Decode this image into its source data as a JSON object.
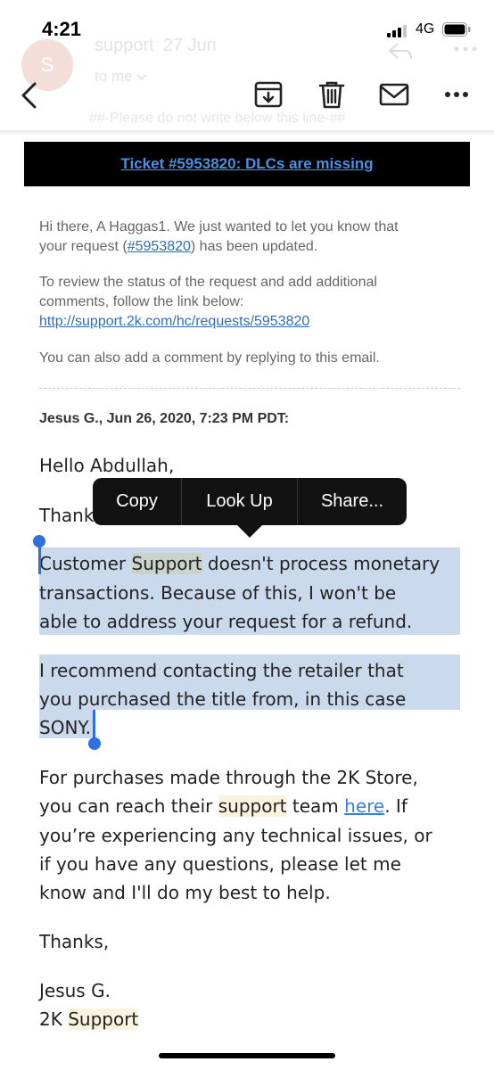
{
  "status_bar": {
    "time": "4:21",
    "network": "4G"
  },
  "ghost_header": {
    "avatar_letter": "S",
    "sender": "support",
    "date": "27 Jun",
    "to": "to me",
    "note": "##-Please do not write below this line-##"
  },
  "toolbar": {
    "back_icon": "chevron-left-icon",
    "archive_icon": "archive-icon",
    "delete_icon": "trash-icon",
    "mark_icon": "envelope-icon",
    "more_icon": "more-icon"
  },
  "email": {
    "ticket_title": "Ticket #5953820: DLCs are missing",
    "intro": {
      "line1": "Hi there, A Haggas1. We just wanted to let you know that",
      "line2_prefix": "your request (",
      "line2_link": "#5953820",
      "line2_suffix": ") has been updated.",
      "review_line1": "To review the status of the request and add additional",
      "review_line2": "comments, follow the link below:",
      "review_link": "http://support.2k.com/hc/requests/5953820",
      "reply_note": "You can also add a comment by replying to this email."
    },
    "author_line": "Jesus G., Jun 26, 2020, 7:23 PM PDT:",
    "body": {
      "greeting": "Hello Abdullah,",
      "thanks_partial": "Thank",
      "p1_l1_a": "Customer ",
      "p1_l1_hl": "Support",
      "p1_l1_b": " doesn't process monetary",
      "p1_l2": "transactions. Because of this, I won't be",
      "p1_l3": "able to address your request for a refund.",
      "p2_l1": "I recommend contacting the retailer that",
      "p2_l2": "you purchased the title from, in this case",
      "p2_l3": "SONY.",
      "p3_l1": "For purchases made through the 2K Store,",
      "p3_l2_a": "you can reach their ",
      "p3_l2_hl": "support",
      "p3_l2_b": " team ",
      "p3_l2_link": "here",
      "p3_l2_c": ". If",
      "p3_l3": "you’re experiencing any technical issues, or",
      "p3_l4": "if you have any questions, please let me",
      "p3_l5": "know and I'll do my best to help.",
      "closing": "Thanks,",
      "sig_name": "Jesus G.",
      "sig_team_a": "2K ",
      "sig_team_hl": "Support"
    }
  },
  "context_menu": {
    "copy": "Copy",
    "look_up": "Look Up",
    "share": "Share..."
  },
  "colors": {
    "selection": "#cbd9ec",
    "highlight": "#fbf3dd",
    "link": "#3b7ddd",
    "handle": "#2f6fde"
  }
}
